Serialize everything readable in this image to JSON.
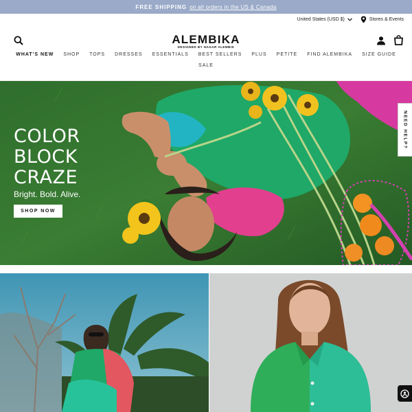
{
  "announcement": {
    "strong": "FREE SHIPPING",
    "link": "on all orders in the US & Canada"
  },
  "utility": {
    "currency": "United States (USD $)",
    "stores": "Stores & Events"
  },
  "brand": {
    "logo": "ALEMBIKA",
    "tagline": "DESIGNED BY HAGAR ALEMBIK"
  },
  "nav": {
    "row1": [
      "WHAT'S NEW",
      "SHOP",
      "TOPS",
      "DRESSES",
      "ESSENTIALS",
      "BEST SELLERS",
      "PLUS",
      "PETITE",
      "FIND ALEMBIKA",
      "SIZE GUIDE"
    ],
    "row2": [
      "SALE"
    ]
  },
  "hero": {
    "title_line1": "COLOR",
    "title_line2": "BLOCK",
    "title_line3": "CRAZE",
    "subtitle": "Bright. Bold. Alive.",
    "cta": "SHOP NOW"
  },
  "help_tab": "NEED HELP?",
  "icons": {
    "search": "search-icon",
    "account": "account-icon",
    "cart": "cart-icon",
    "pin": "location-pin-icon",
    "chevron": "chevron-down-icon",
    "chat": "chat-icon"
  },
  "colors": {
    "announcement_bg": "#9aaac8",
    "grass": "#2e6a2c",
    "top_green": "#1fa867",
    "magenta": "#d63aa0"
  }
}
